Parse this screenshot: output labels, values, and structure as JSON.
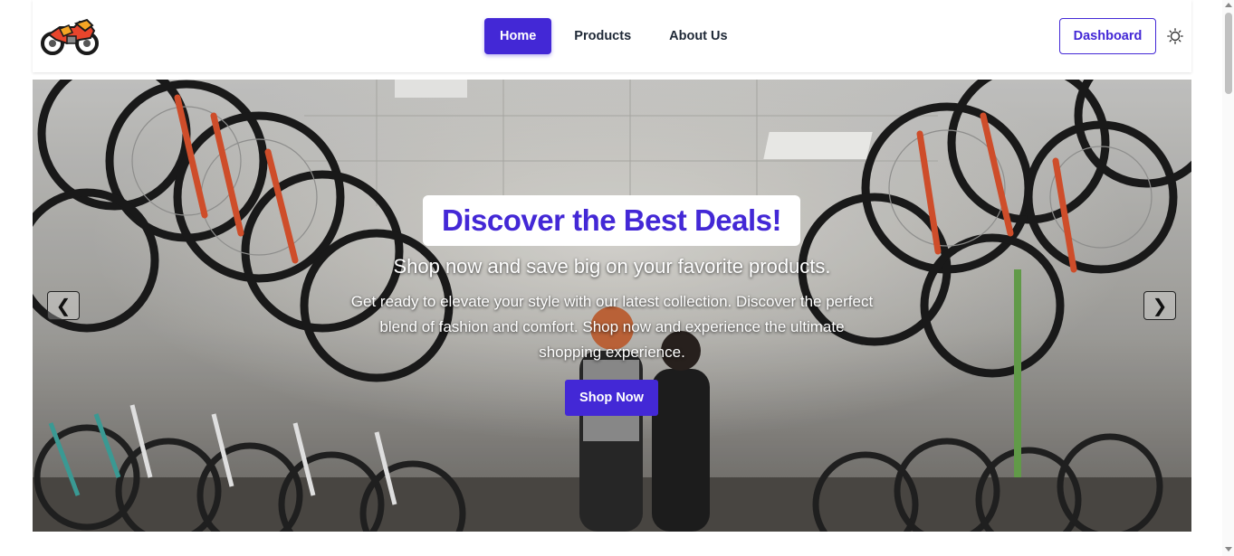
{
  "nav": {
    "logo_icon": "motorcycle-icon",
    "links": [
      {
        "label": "Home",
        "active": true
      },
      {
        "label": "Products",
        "active": false
      },
      {
        "label": "About Us",
        "active": false
      }
    ],
    "dashboard_label": "Dashboard",
    "theme_icon": "sun-icon"
  },
  "hero": {
    "background": "bicycle shop photo",
    "title": "Discover the Best Deals!",
    "subtitle": "Shop now and save big on your favorite products.",
    "description": "Get ready to elevate your style with our latest collection. Discover the perfect blend of fashion and comfort. Shop now and experience the ultimate shopping experience.",
    "cta_label": "Shop Now",
    "prev_label": "❮",
    "next_label": "❯"
  },
  "colors": {
    "primary": "#4328d6",
    "text_dark": "#1f2937"
  }
}
